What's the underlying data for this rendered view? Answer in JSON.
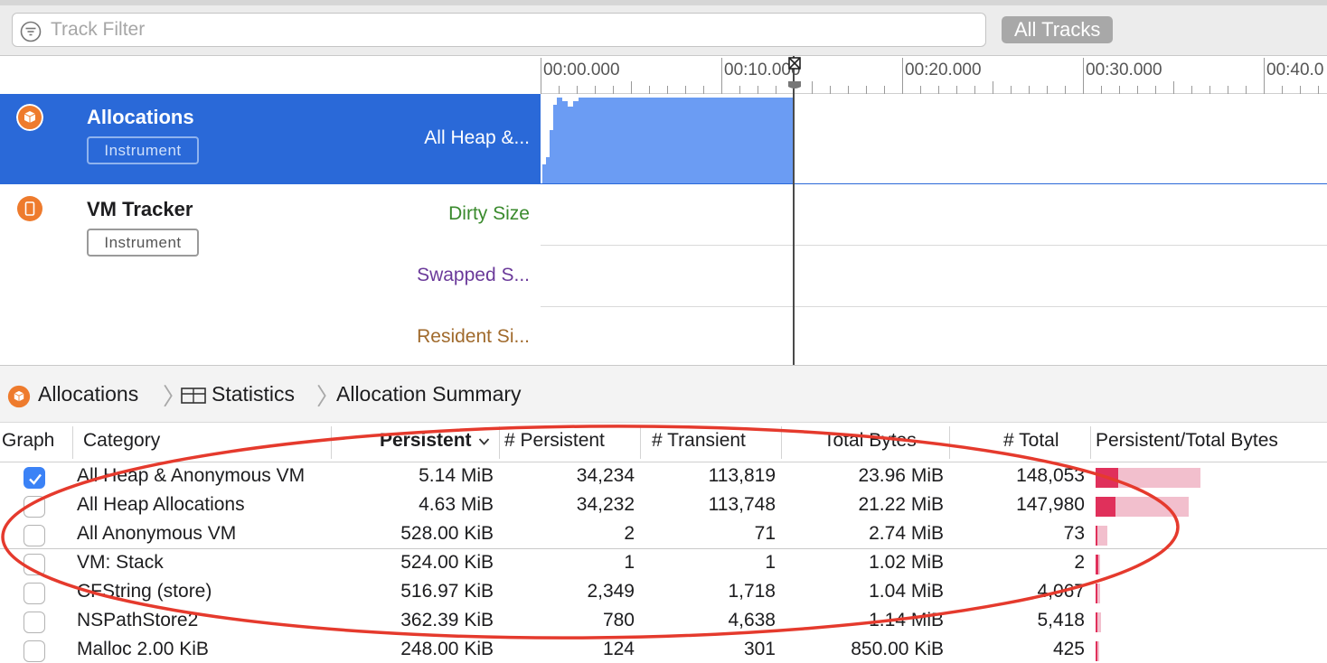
{
  "filter": {
    "placeholder": "Track Filter",
    "all_tracks_label": "All Tracks"
  },
  "timeline": {
    "ticks": [
      "00:00.000",
      "00:10.000",
      "00:20.000",
      "00:30.000",
      "00:40.0"
    ]
  },
  "tracks": [
    {
      "title": "Allocations",
      "badge": "Instrument",
      "selected": true,
      "lanes": [
        "All Heap &..."
      ]
    },
    {
      "title": "VM Tracker",
      "badge": "Instrument",
      "selected": false,
      "lanes": [
        "Dirty Size",
        "Swapped S...",
        "Resident Si..."
      ]
    }
  ],
  "colors": {
    "selection": "#2a69d8",
    "graph_fill": "#6b9cf3",
    "dirty_size": "#3a8a2d",
    "swapped": "#6b3a9a",
    "resident": "#a06a2c",
    "instrument_orange": "#ee7b2d",
    "annotation_red": "#e53a2d"
  },
  "breadcrumb": {
    "instrument": "Allocations",
    "view": "Statistics",
    "detail": "Allocation Summary"
  },
  "table": {
    "columns": [
      "Graph",
      "Category",
      "Persistent",
      "# Persistent",
      "# Transient",
      "Total Bytes",
      "# Total",
      "Persistent/Total Bytes"
    ],
    "sort_column": "Persistent",
    "rows": [
      {
        "checked": true,
        "category": "All Heap & Anonymous VM",
        "persistent": "5.14 MiB",
        "n_persistent": "34,234",
        "n_transient": "113,819",
        "total_bytes": "23.96 MiB",
        "n_total": "148,053",
        "ratio": 0.2145,
        "total_frac": 1.0
      },
      {
        "checked": false,
        "category": "All Heap Allocations",
        "persistent": "4.63 MiB",
        "n_persistent": "34,232",
        "n_transient": "113,748",
        "total_bytes": "21.22 MiB",
        "n_total": "147,980",
        "ratio": 0.2182,
        "total_frac": 0.886
      },
      {
        "checked": false,
        "category": "All Anonymous VM",
        "persistent": "528.00 KiB",
        "n_persistent": "2",
        "n_transient": "71",
        "total_bytes": "2.74 MiB",
        "n_total": "73",
        "ratio": 0.188,
        "total_frac": 0.114
      },
      {
        "checked": false,
        "category": "VM: Stack",
        "persistent": "524.00 KiB",
        "n_persistent": "1",
        "n_transient": "1",
        "total_bytes": "1.02 MiB",
        "n_total": "2",
        "ratio": 0.5,
        "total_frac": 0.043
      },
      {
        "checked": false,
        "category": "CFString (store)",
        "persistent": "516.97 KiB",
        "n_persistent": "2,349",
        "n_transient": "1,718",
        "total_bytes": "1.04 MiB",
        "n_total": "4,067",
        "ratio": 0.485,
        "total_frac": 0.043
      },
      {
        "checked": false,
        "category": "NSPathStore2",
        "persistent": "362.39 KiB",
        "n_persistent": "780",
        "n_transient": "4,638",
        "total_bytes": "1.14 MiB",
        "n_total": "5,418",
        "ratio": 0.31,
        "total_frac": 0.048
      },
      {
        "checked": false,
        "category": "Malloc 2.00 KiB",
        "persistent": "248.00 KiB",
        "n_persistent": "124",
        "n_transient": "301",
        "total_bytes": "850.00 KiB",
        "n_total": "425",
        "ratio": 0.29,
        "total_frac": 0.035
      }
    ]
  }
}
